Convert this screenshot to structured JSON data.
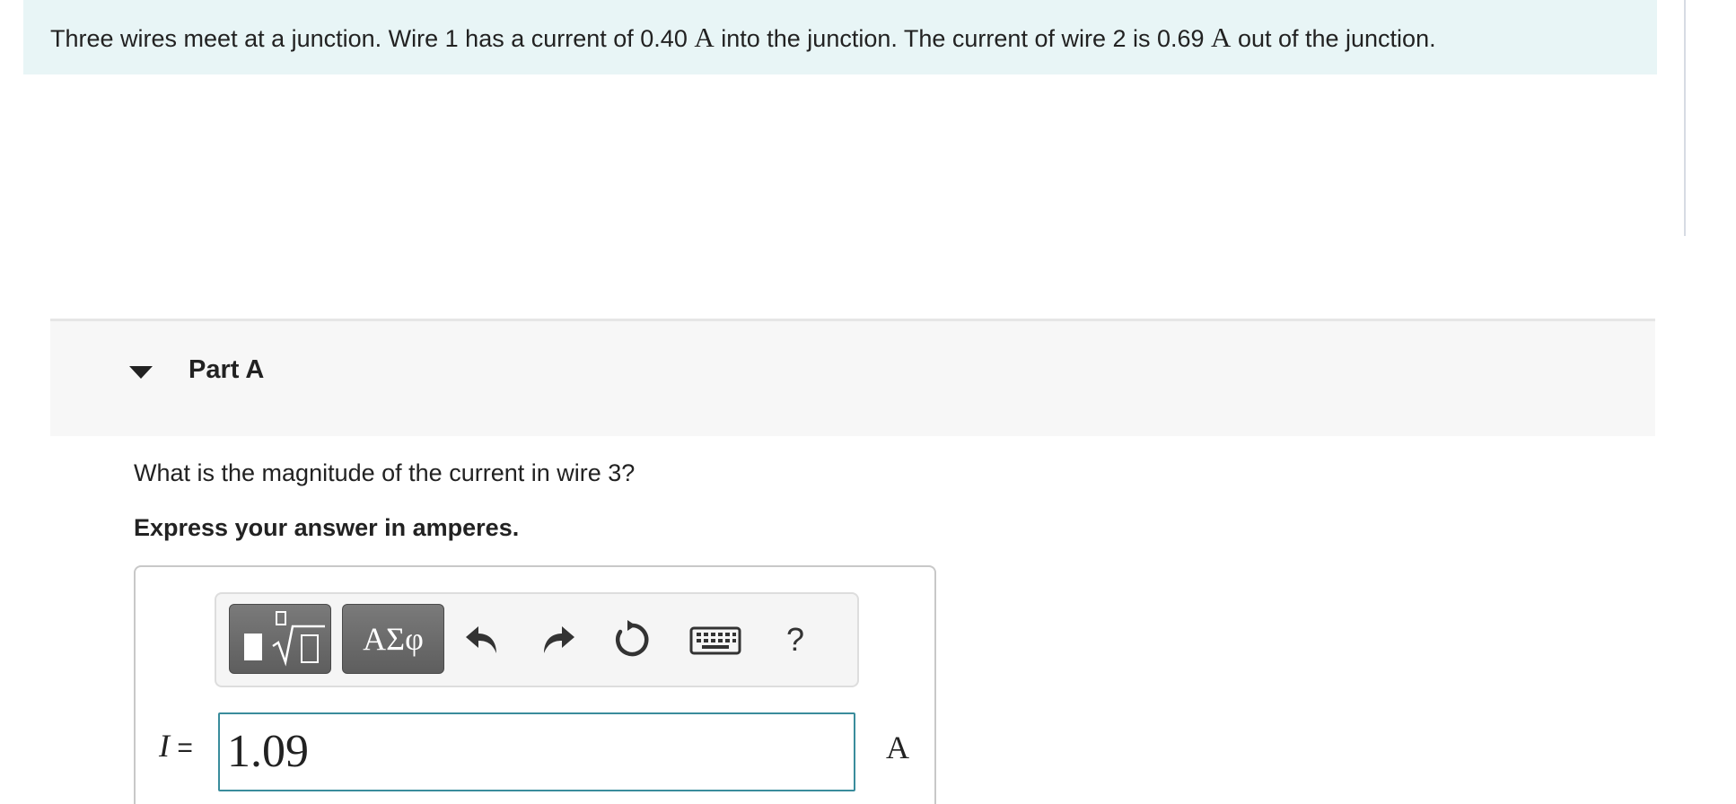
{
  "problem": {
    "text_part1": "Three wires meet at a junction. Wire 1 has a current of 0.40 ",
    "unit1": "A",
    "text_part2": " into the junction. The current of wire 2 is 0.69 ",
    "unit2": "A",
    "text_part3": " out of the junction."
  },
  "part": {
    "title": "Part A",
    "question": "What is the magnitude of the current in wire 3?",
    "instruction": "Express your answer in amperes."
  },
  "toolbar": {
    "templates_icon": "templates-icon",
    "symbols_label": "ΑΣφ",
    "undo_icon": "undo-icon",
    "redo_icon": "redo-icon",
    "reset_icon": "reset-icon",
    "keyboard_icon": "keyboard-icon",
    "help_label": "?"
  },
  "answer": {
    "variable": "I",
    "equals": " =",
    "value": "1.09",
    "unit": "A"
  },
  "colors": {
    "banner_bg": "#e8f5f6",
    "input_border": "#3a8c9c",
    "tool_button": "#6b6b6b"
  }
}
